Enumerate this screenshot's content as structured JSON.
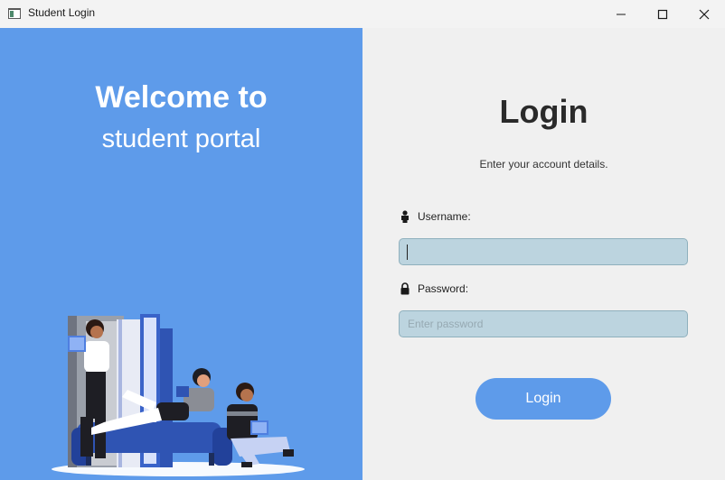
{
  "window": {
    "title": "Student Login",
    "icons": {
      "app": "app-window-icon",
      "minimize": "minimize-icon",
      "maximize": "maximize-icon",
      "close": "close-icon"
    }
  },
  "left_panel": {
    "welcome_line1": "Welcome to",
    "welcome_line2": "student portal",
    "background_color": "#5e9bea",
    "illustration": "students-reading-on-sofa-illustration"
  },
  "login": {
    "title": "Login",
    "subtitle": "Enter your account details.",
    "username_label": "Username:",
    "username_icon": "person-icon",
    "username_value": "",
    "password_label": "Password:",
    "password_icon": "lock-icon",
    "password_placeholder": "Enter password",
    "button_label": "Login",
    "button_color": "#5e9bea"
  }
}
